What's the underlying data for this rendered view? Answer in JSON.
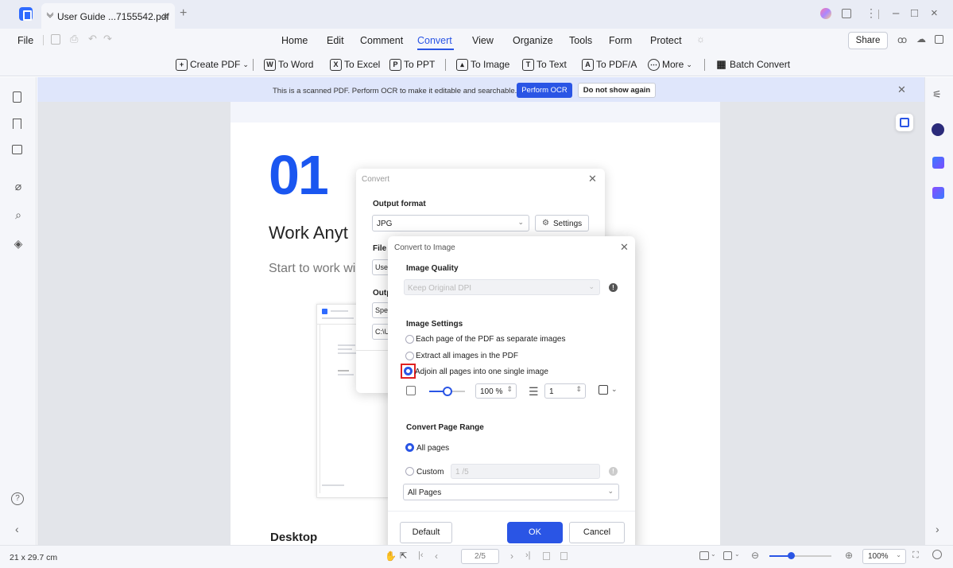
{
  "window": {
    "tab_title": "User Guide ...7155542.pdf",
    "tab_close": "×",
    "new_tab": "+",
    "controls": {
      "minimize": "–",
      "maximize": "□",
      "close": "×"
    }
  },
  "menu": {
    "file": "File",
    "items": [
      "Home",
      "Edit",
      "Comment",
      "Convert",
      "View",
      "Organize",
      "Tools",
      "Form",
      "Protect"
    ],
    "active": "Convert",
    "share": "Share"
  },
  "toolbar": {
    "create_pdf": "Create PDF",
    "to_word": "To Word",
    "to_excel": "To Excel",
    "to_ppt": "To PPT",
    "to_image": "To Image",
    "to_text": "To Text",
    "to_pdfa": "To PDF/A",
    "more": "More",
    "batch_convert": "Batch Convert"
  },
  "ocr_banner": {
    "message": "This is a scanned PDF. Perform OCR to make it editable and searchable.",
    "perform_ocr": "Perform OCR",
    "dismiss": "Do not show again"
  },
  "page": {
    "number": "01",
    "heading": "Work Anyt",
    "subtitle": "Start to work wi",
    "desktop": "Desktop"
  },
  "convert_dialog": {
    "title": "Convert",
    "output_format_label": "Output format",
    "format_value": "JPG",
    "settings": "Settings",
    "file_label": "File",
    "file_value": "User",
    "output_label": "Outp",
    "output_value": "Spec",
    "path_value": "C:\\U"
  },
  "image_dialog": {
    "title": "Convert to Image",
    "quality_label": "Image Quality",
    "quality_value": "Keep Original DPI",
    "settings_label": "Image Settings",
    "options": [
      {
        "label": "Each page of the PDF as separate images",
        "selected": false
      },
      {
        "label": "Extract all images in the PDF",
        "selected": false
      },
      {
        "label": "Adjoin all pages into one single image",
        "selected": true
      }
    ],
    "zoom_value": "100 %",
    "zoom_slider_fraction": 0.5,
    "columns_value": "1",
    "range_label": "Convert Page Range",
    "range_all": "All pages",
    "range_custom": "Custom",
    "range_custom_value": "1 /5",
    "subset_value": "All Pages",
    "default_btn": "Default",
    "ok_btn": "OK",
    "cancel_btn": "Cancel",
    "accent": "#2a55e5",
    "highlight": "#e02020"
  },
  "status": {
    "page_size": "21 x 29.7 cm",
    "page_indicator": "2/5",
    "zoom": "100%",
    "zoom_slider_fraction": 0.35
  }
}
